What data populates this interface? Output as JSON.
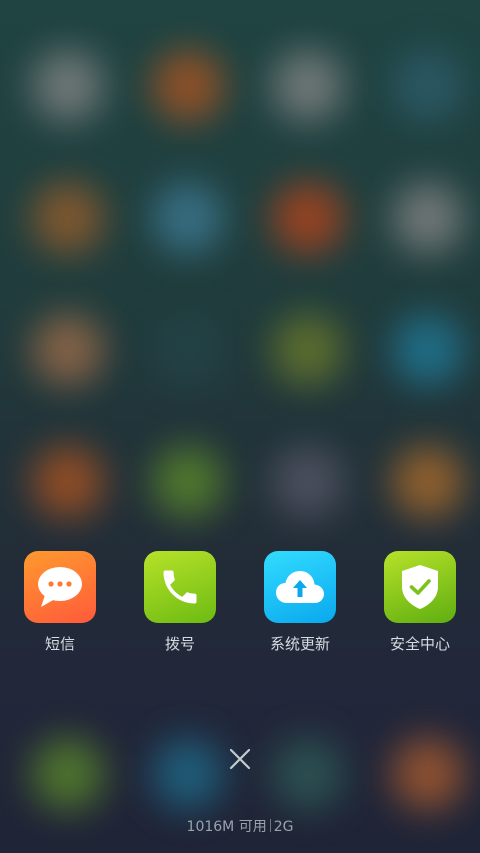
{
  "background": {
    "blurred_icon_colors": [
      [
        "#8a8a8a",
        "#b5561f",
        "#8a8a8a",
        "#2f5f6f"
      ],
      [
        "#a0602a",
        "#3f7f9a",
        "#c04418",
        "#8a8a8a"
      ],
      [
        "#a6704a",
        "#24464a",
        "#6f7f2a",
        "#1f7f9f"
      ],
      [
        "#b5561f",
        "#5f8f2a",
        "#5a5a6a",
        "#b5702a"
      ],
      [
        "#5f8f2a",
        "#1f6f8f",
        "#2f5f5a",
        "#b5602f"
      ]
    ]
  },
  "dock": {
    "apps": [
      {
        "name": "sms",
        "label": "短信",
        "icon": "message-bubble-icon",
        "colors": [
          "#ff9a2e",
          "#ff5a3a"
        ]
      },
      {
        "name": "dialer",
        "label": "拨号",
        "icon": "phone-icon",
        "colors": [
          "#b7e22a",
          "#6dbb12"
        ]
      },
      {
        "name": "system-update",
        "label": "系统更新",
        "icon": "cloud-upload-icon",
        "colors": [
          "#33dcff",
          "#0aa8ee"
        ]
      },
      {
        "name": "security-center",
        "label": "安全中心",
        "icon": "shield-check-icon",
        "colors": [
          "#b7e22a",
          "#5fae10"
        ]
      }
    ]
  },
  "close_button": {
    "icon": "close-icon"
  },
  "status": {
    "memory": "1016M 可用",
    "network": "2G"
  }
}
